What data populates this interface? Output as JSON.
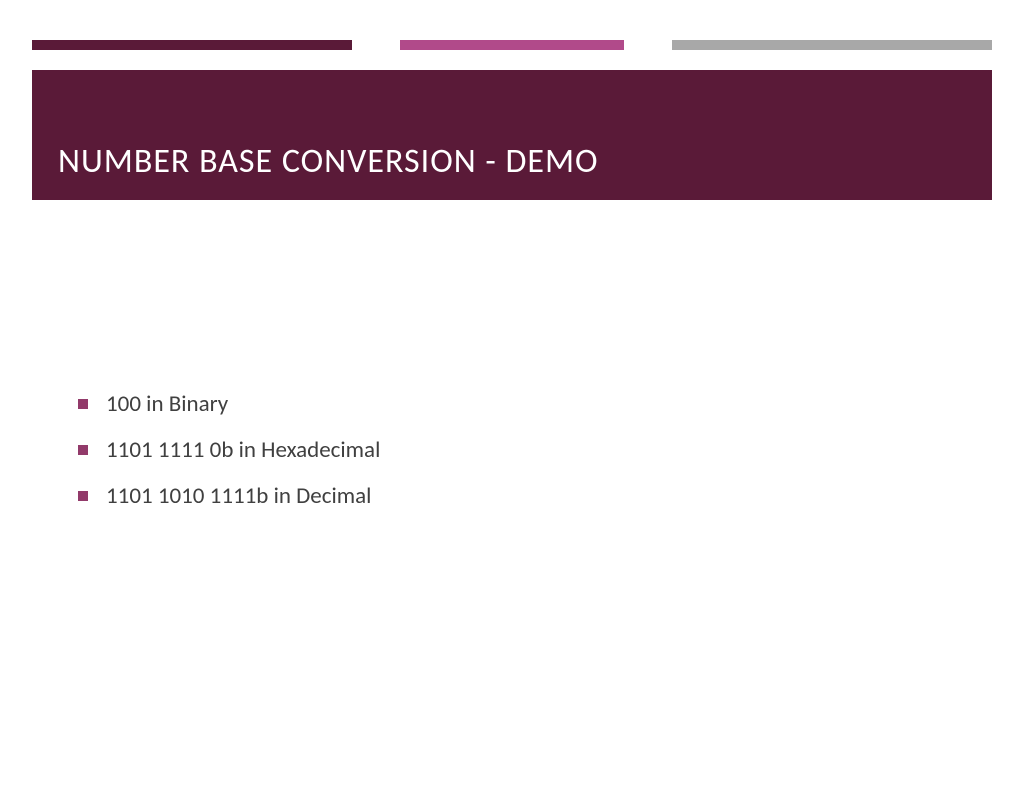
{
  "slide": {
    "title": "NUMBER BASE CONVERSION - DEMO",
    "bullets": [
      "100 in Binary",
      "1101 1111 0b in Hexadecimal",
      "1101 1010 1111b in Decimal"
    ]
  },
  "colors": {
    "primary": "#5a1a38",
    "accent": "#b14a8a",
    "neutral": "#a8a8a8",
    "bullet": "#923a6a"
  }
}
